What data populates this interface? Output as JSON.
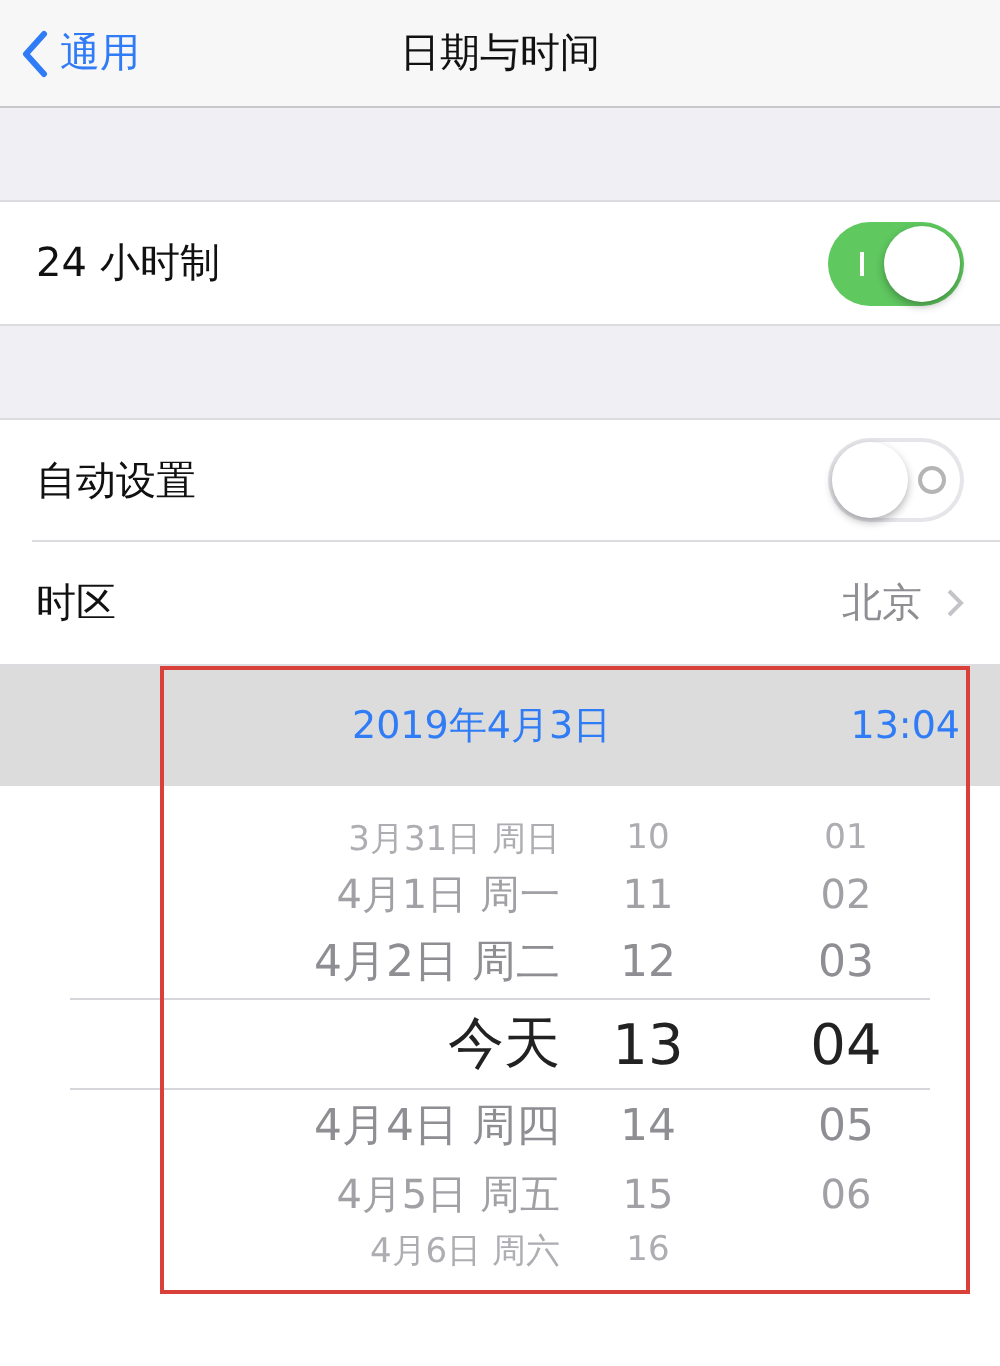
{
  "nav": {
    "back": "通用",
    "title": "日期与时间"
  },
  "hour_format": {
    "label": "24 小时制",
    "on": true
  },
  "auto_set": {
    "label": "自动设置",
    "on": false
  },
  "time_zone": {
    "label": "时区",
    "value": "北京"
  },
  "date_bar": {
    "date": "2019年4月3日",
    "time": "13:04"
  },
  "picker_rows": [
    {
      "date": "3月31日 周日",
      "hour": "10",
      "minute": "01",
      "selected": false
    },
    {
      "date": "4月1日 周一",
      "hour": "11",
      "minute": "02",
      "selected": false
    },
    {
      "date": "4月2日 周二",
      "hour": "12",
      "minute": "03",
      "selected": false
    },
    {
      "date": "今天",
      "hour": "13",
      "minute": "04",
      "selected": true
    },
    {
      "date": "4月4日 周四",
      "hour": "14",
      "minute": "05",
      "selected": false
    },
    {
      "date": "4月5日 周五",
      "hour": "15",
      "minute": "06",
      "selected": false
    },
    {
      "date": "4月6日 周六",
      "hour": "16",
      "selected": false
    }
  ]
}
